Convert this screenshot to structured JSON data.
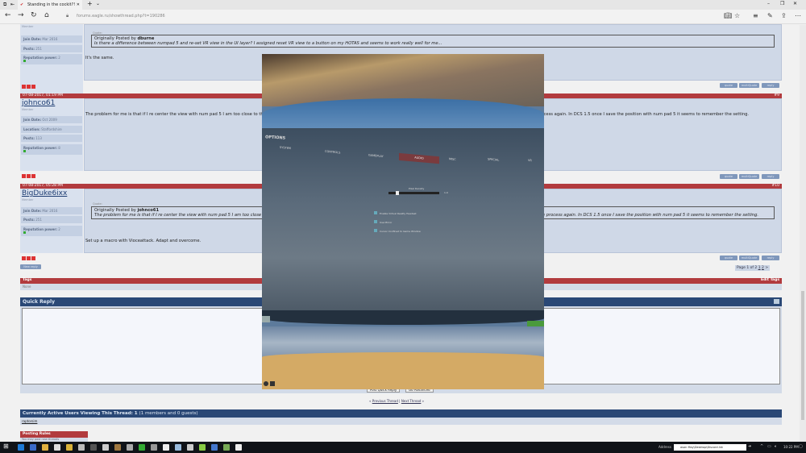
{
  "browser": {
    "tab_title": "Standing in the cockit?!",
    "url": "forums.eagle.ru/showthread.php?t=190286"
  },
  "posts": [
    {
      "username": "",
      "rank": "Member",
      "info": [
        {
          "k": "Join Date:",
          "v": "Mar 2016"
        },
        {
          "k": "Posts:",
          "v": "251"
        },
        {
          "k": "Reputation power:",
          "v": "2"
        }
      ],
      "quote_label": "Quote:",
      "quote_prefix": "Originally Posted by",
      "quote_author": "dburne",
      "quote_text": "Is there a difference between numpad 5 and re-set VR view in the UI layer? I assigned reset VR view to a button on my HOTAS and seems to work really well for me...",
      "text": "It's the same."
    },
    {
      "date": "07-08-2017, 01:19 PM",
      "number": "#9",
      "username": "johnco61",
      "rank": "Member",
      "info": [
        {
          "k": "Join Date:",
          "v": "Oct 2009"
        },
        {
          "k": "Location:",
          "v": "Staffordshire"
        },
        {
          "k": "Posts:",
          "v": "113"
        },
        {
          "k": "Reputation power:",
          "v": "8"
        }
      ],
      "text": "The problem for me is that if I re center the view with num pad 5 I am too close to the HUD. Then I have to back out and re center fine. When I re start the mission I'm to close to the HUD and have to go through the process again. In DCS 1.5 once I save the position with num pad 5 it seems to remember the setting."
    },
    {
      "date": "07-08-2017, 05:28 PM",
      "number": "#10",
      "username": "BigDuke6ixx",
      "rank": "Member",
      "info": [
        {
          "k": "Join Date:",
          "v": "Mar 2016"
        },
        {
          "k": "Posts:",
          "v": "251"
        },
        {
          "k": "Reputation power:",
          "v": "2"
        }
      ],
      "quote_label": "Quote:",
      "quote_prefix": "Originally Posted by",
      "quote_author": "johnco61",
      "quote_text": "The problem for me is that if I re center the view with num pad 5 I am too close to the HUD. Then I have to back out and re center fine. When I re start the mission I'm to close to the HUD and have to go through the process again. In DCS 1.5 once I save the position with num pad 5 it seems to remember the setting.",
      "text": "Set up a macro with Vioceattack. Adapt and overcome."
    }
  ],
  "buttons": {
    "quote": "quote",
    "multiquote": "multiQuote",
    "reply": "reply",
    "new_reply": "New reply",
    "post_quick": "Post Quick Reply",
    "go_advanced": "Go Advanced"
  },
  "pagination": {
    "label": "Page 1 of 2",
    "pages": [
      "1",
      "2"
    ],
    "next": ">"
  },
  "tags": {
    "title": "Tags",
    "edit": "Edit Tags",
    "value": "None"
  },
  "quick_reply": {
    "title": "Quick Reply"
  },
  "thread_nav": {
    "prev": "Previous Thread",
    "sep": "|",
    "next": "Next Thread"
  },
  "active_users": {
    "title": "Currently Active Users Viewing This Thread: 1",
    "detail": "(1 members and 0 guests)",
    "user": "raptorsim"
  },
  "posting_rules": {
    "title": "Posting Rules",
    "text": "You may post new threads"
  },
  "vr_options": {
    "title": "OPTIONS",
    "tabs": [
      "SYSTEM",
      "CONTROLS",
      "GAMEPLAY",
      "AUDIO",
      "MISC",
      "SPECIAL",
      "VR"
    ],
    "active_tab": "AUDIO",
    "slider_label": "Pixel Density",
    "slider_value": "1.0",
    "slider_fraction": 0.15,
    "checkboxes": [
      "Enable Virtual Reality Headset",
      "Use Mirror",
      "Cursor Confined to Game Window"
    ]
  },
  "taskbar": {
    "address_label": "Address",
    "address_value": "ason May\\Desktop\\Discord.lnk",
    "time": "10:22 PM"
  }
}
